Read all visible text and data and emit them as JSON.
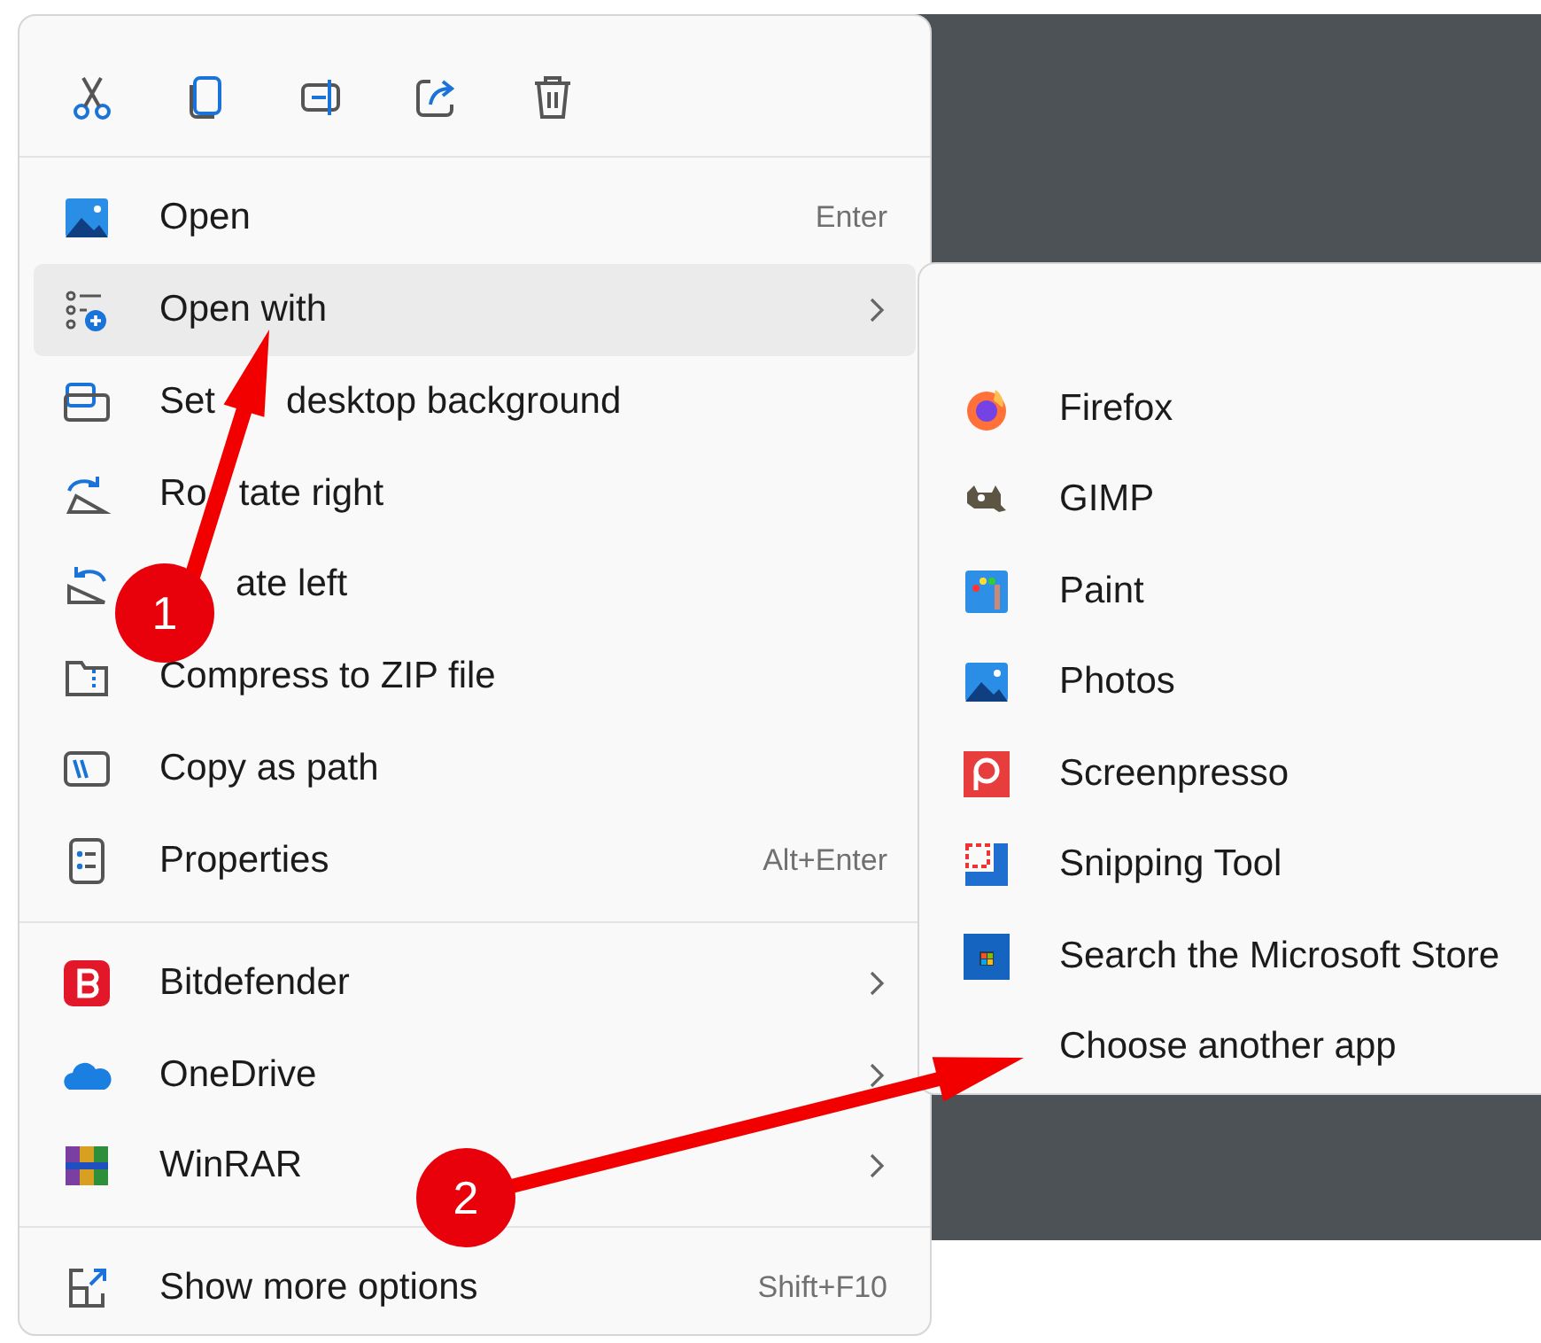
{
  "toolbar": [
    {
      "kind": "cut"
    },
    {
      "kind": "copy"
    },
    {
      "kind": "rename"
    },
    {
      "kind": "share"
    },
    {
      "kind": "delete"
    }
  ],
  "sections": [
    [
      {
        "label": [
          "Open"
        ],
        "kind": "photos",
        "shortcut": "Enter",
        "submenu": false,
        "selected": false
      },
      {
        "label": [
          "Open with"
        ],
        "kind": "openwith",
        "submenu": true,
        "selected": true
      },
      {
        "label": [
          "Set",
          "desktop background"
        ],
        "kind": "wallpaper",
        "submenu": false,
        "selected": false
      },
      {
        "label": [
          "Ro",
          "tate right"
        ],
        "kind": "rotright",
        "submenu": false,
        "selected": false
      },
      {
        "label": [
          "ate left"
        ],
        "kind": "rotleft",
        "submenu": false,
        "selected": false
      },
      {
        "label": [
          "Compress to ZIP file"
        ],
        "kind": "zip",
        "submenu": false,
        "selected": false
      },
      {
        "label": [
          "Copy as path"
        ],
        "kind": "path",
        "submenu": false,
        "selected": false
      },
      {
        "label": [
          "Properties"
        ],
        "kind": "props",
        "shortcut": "Alt+Enter",
        "submenu": false,
        "selected": false
      }
    ],
    [
      {
        "label": [
          "Bitdefender"
        ],
        "kind": "bitdefender",
        "submenu": true,
        "selected": false
      },
      {
        "label": [
          "OneDrive"
        ],
        "kind": "cloud",
        "submenu": true,
        "selected": false
      },
      {
        "label": [
          "WinRAR"
        ],
        "kind": "winrar",
        "submenu": true,
        "selected": false
      }
    ],
    [
      {
        "label": [
          "Show more options"
        ],
        "kind": "more",
        "shortcut": "Shift+F10",
        "submenu": false,
        "selected": false
      }
    ]
  ],
  "open_with": [
    {
      "label": "Firefox",
      "kind": "firefox"
    },
    {
      "label": "GIMP",
      "kind": "gimp"
    },
    {
      "label": "Paint",
      "kind": "paint"
    },
    {
      "label": "Photos",
      "kind": "photos"
    },
    {
      "label": "Screenpresso",
      "kind": "screenpresso"
    },
    {
      "label": "Snipping Tool",
      "kind": "snip"
    },
    {
      "label": "Search the Microsoft Store",
      "kind": "store"
    },
    {
      "label": "Choose another app",
      "kind": "plain"
    }
  ],
  "annotations": [
    {
      "label": "1"
    },
    {
      "label": "2"
    }
  ]
}
